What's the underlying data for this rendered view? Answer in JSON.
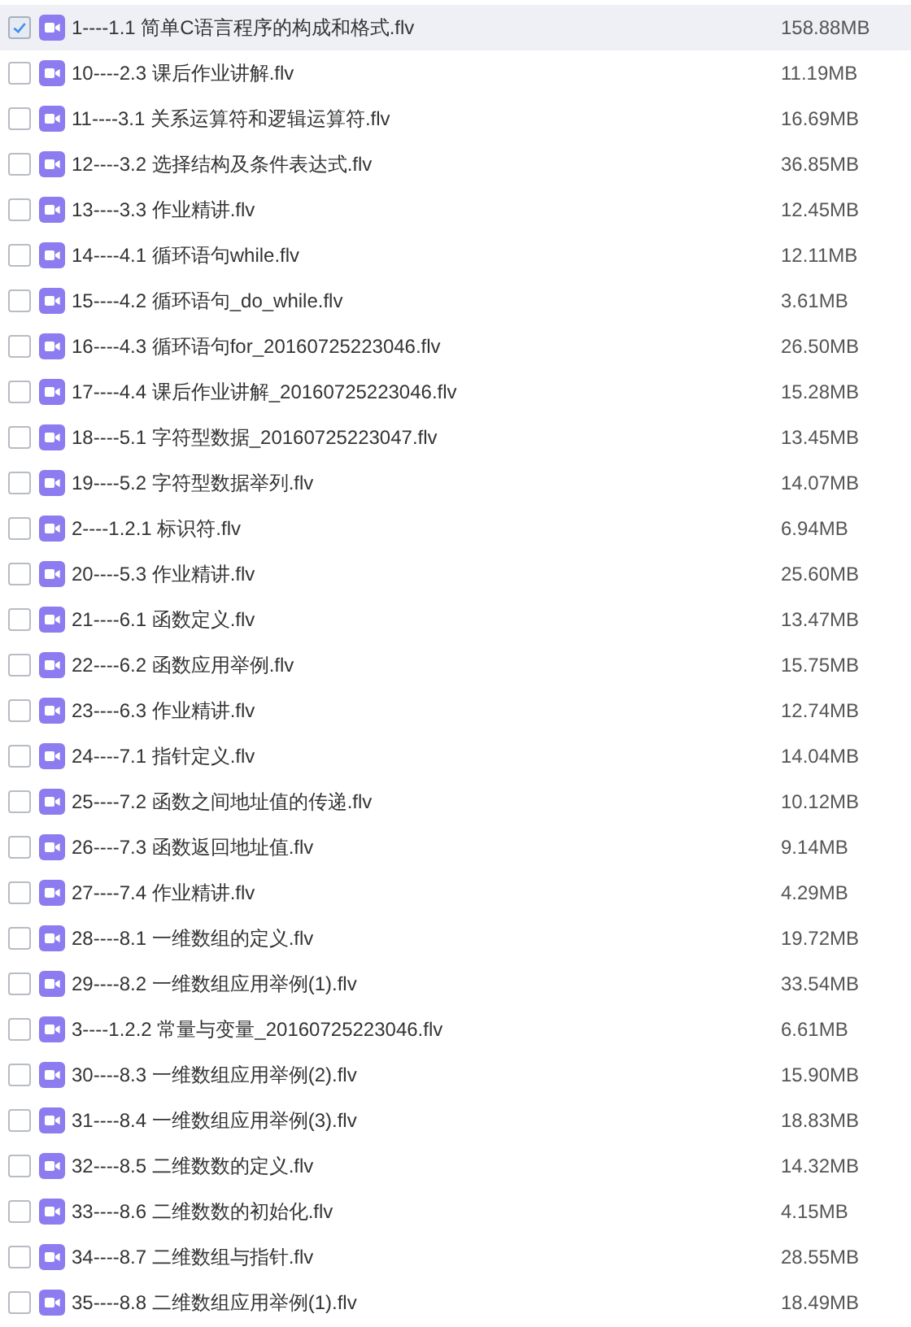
{
  "files": [
    {
      "name": "1----1.1 简单C语言程序的构成和格式.flv",
      "size": "158.88MB",
      "selected": true
    },
    {
      "name": "10----2.3 课后作业讲解.flv",
      "size": "11.19MB",
      "selected": false
    },
    {
      "name": "11----3.1 关系运算符和逻辑运算符.flv",
      "size": "16.69MB",
      "selected": false
    },
    {
      "name": "12----3.2 选择结构及条件表达式.flv",
      "size": "36.85MB",
      "selected": false
    },
    {
      "name": "13----3.3 作业精讲.flv",
      "size": "12.45MB",
      "selected": false
    },
    {
      "name": "14----4.1 循环语句while.flv",
      "size": "12.11MB",
      "selected": false
    },
    {
      "name": "15----4.2 循环语句_do_while.flv",
      "size": "3.61MB",
      "selected": false
    },
    {
      "name": "16----4.3 循环语句for_20160725223046.flv",
      "size": "26.50MB",
      "selected": false
    },
    {
      "name": "17----4.4 课后作业讲解_20160725223046.flv",
      "size": "15.28MB",
      "selected": false
    },
    {
      "name": "18----5.1 字符型数据_20160725223047.flv",
      "size": "13.45MB",
      "selected": false
    },
    {
      "name": "19----5.2 字符型数据举列.flv",
      "size": "14.07MB",
      "selected": false
    },
    {
      "name": "2----1.2.1 标识符.flv",
      "size": "6.94MB",
      "selected": false
    },
    {
      "name": "20----5.3 作业精讲.flv",
      "size": "25.60MB",
      "selected": false
    },
    {
      "name": "21----6.1 函数定义.flv",
      "size": "13.47MB",
      "selected": false
    },
    {
      "name": "22----6.2 函数应用举例.flv",
      "size": "15.75MB",
      "selected": false
    },
    {
      "name": "23----6.3 作业精讲.flv",
      "size": "12.74MB",
      "selected": false
    },
    {
      "name": "24----7.1 指针定义.flv",
      "size": "14.04MB",
      "selected": false
    },
    {
      "name": "25----7.2 函数之间地址值的传递.flv",
      "size": "10.12MB",
      "selected": false
    },
    {
      "name": "26----7.3 函数返回地址值.flv",
      "size": "9.14MB",
      "selected": false
    },
    {
      "name": "27----7.4 作业精讲.flv",
      "size": "4.29MB",
      "selected": false
    },
    {
      "name": "28----8.1 一维数组的定义.flv",
      "size": "19.72MB",
      "selected": false
    },
    {
      "name": "29----8.2 一维数组应用举例(1).flv",
      "size": "33.54MB",
      "selected": false
    },
    {
      "name": "3----1.2.2 常量与变量_20160725223046.flv",
      "size": "6.61MB",
      "selected": false
    },
    {
      "name": "30----8.3 一维数组应用举例(2).flv",
      "size": "15.90MB",
      "selected": false
    },
    {
      "name": "31----8.4 一维数组应用举例(3).flv",
      "size": "18.83MB",
      "selected": false
    },
    {
      "name": "32----8.5 二维数数的定义.flv",
      "size": "14.32MB",
      "selected": false
    },
    {
      "name": "33----8.6 二维数数的初始化.flv",
      "size": "4.15MB",
      "selected": false
    },
    {
      "name": "34----8.7 二维数组与指针.flv",
      "size": "28.55MB",
      "selected": false
    },
    {
      "name": "35----8.8 二维数组应用举例(1).flv",
      "size": "18.49MB",
      "selected": false
    }
  ]
}
